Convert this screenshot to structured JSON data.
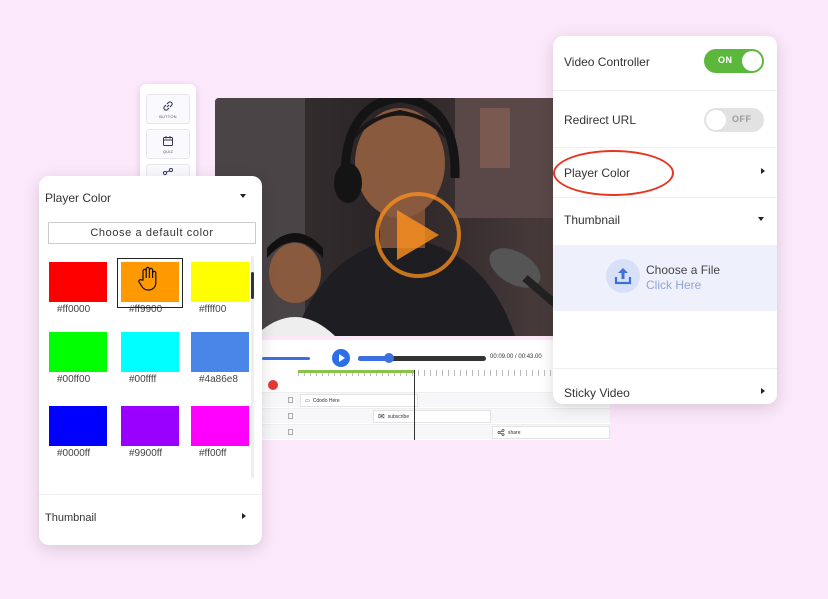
{
  "toolstrip": {
    "tools": [
      {
        "label": "BUTTON",
        "icon": "link-icon"
      },
      {
        "label": "QUIZ",
        "icon": "calendar-icon"
      },
      {
        "label": "",
        "icon": "share-icon"
      }
    ]
  },
  "video": {
    "description_icon": "play-icon"
  },
  "timeline": {
    "time_current": "00:09.00",
    "time_sep": "/",
    "time_total": "00:43.00",
    "clips": [
      {
        "label": "Cdodo Here",
        "icon": "text-icon"
      },
      {
        "label": "subscribe",
        "icon": "mail-icon"
      },
      {
        "label": "share",
        "icon": "share-icon"
      }
    ]
  },
  "left_panel": {
    "title": "Player Color",
    "default_button": "Choose a default color",
    "swatches": [
      {
        "hex": "#ff0000",
        "color": "#ff0000"
      },
      {
        "hex": "#ff9900",
        "color": "#ff9900",
        "selected": true
      },
      {
        "hex": "#ffff00",
        "color": "#ffff00"
      },
      {
        "hex": "#00ff00",
        "color": "#00ff00"
      },
      {
        "hex": "#00ffff",
        "color": "#00ffff"
      },
      {
        "hex": "#4a86e8",
        "color": "#4a86e8"
      },
      {
        "hex": "#0000ff",
        "color": "#0000ff"
      },
      {
        "hex": "#9900ff",
        "color": "#9900ff"
      },
      {
        "hex": "#ff00ff",
        "color": "#ff00ff"
      }
    ],
    "thumbnail_label": "Thumbnail"
  },
  "right_panel": {
    "video_controller": {
      "label": "Video Controller",
      "toggle": "ON",
      "state": true
    },
    "redirect_url": {
      "label": "Redirect URL",
      "toggle": "OFF",
      "state": false
    },
    "player_color": {
      "label": "Player Color"
    },
    "thumbnail": {
      "label": "Thumbnail"
    },
    "upload": {
      "title": "Choose a File",
      "subtitle": "Click Here",
      "icon": "upload-icon"
    },
    "sticky_video": {
      "label": "Sticky Video"
    }
  },
  "colors": {
    "background": "#fbe8fb",
    "accent_blue": "#2c6de8",
    "toggle_on": "#5cb83c",
    "highlight_red": "#e8341f"
  }
}
